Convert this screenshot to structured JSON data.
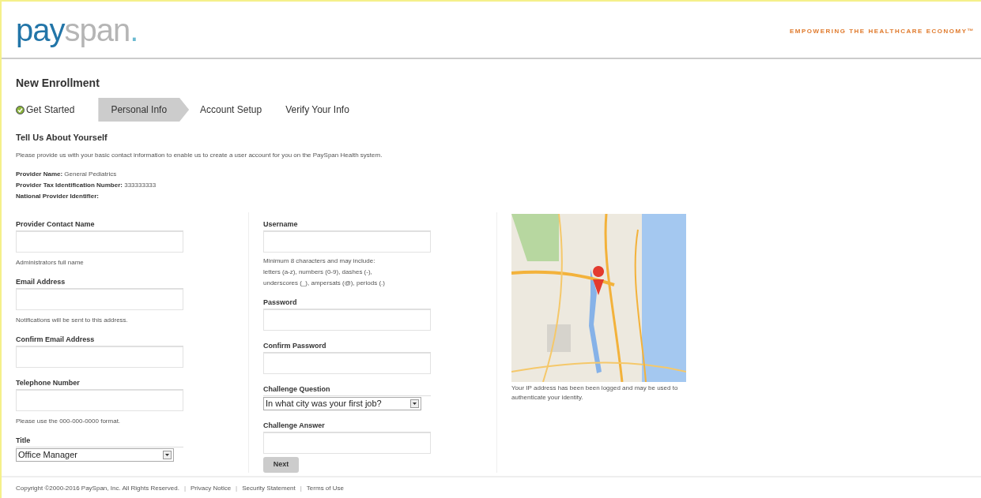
{
  "header": {
    "logo": {
      "first": "pay",
      "second": "span",
      "dot": "."
    },
    "tagline": "EMPOWERING THE HEALTHCARE ECONOMY™"
  },
  "title": "New Enrollment",
  "steps": [
    {
      "label": "Get Started",
      "done": true,
      "selected": false
    },
    {
      "label": "Personal Info",
      "done": false,
      "selected": true
    },
    {
      "label": "Account Setup",
      "done": false,
      "selected": false
    },
    {
      "label": "Verify Your Info",
      "done": false,
      "selected": false
    }
  ],
  "section_title": "Tell Us About Yourself",
  "intro": "Please provide us with your basic contact information to enable us to create a user account for you on the PaySpan Health system.",
  "provider_info": [
    {
      "label": "Provider Name:",
      "value": "General Pediatrics"
    },
    {
      "label": "Provider Tax Identification Number:",
      "value": "333333333"
    },
    {
      "label": "National Provider Identifier:"
    }
  ],
  "left_fields": [
    {
      "kind": "text",
      "label": "Provider Contact Name",
      "hint": "Administrators full name"
    },
    {
      "kind": "text",
      "label": "Email Address",
      "hint": "Notifications will be sent to this address."
    },
    {
      "kind": "text",
      "label": "Confirm Email Address"
    },
    {
      "kind": "text",
      "label": "Telephone Number",
      "hint": "Please use the 000-000-0000 format."
    },
    {
      "kind": "select",
      "label": "Title",
      "value": "Office Manager"
    }
  ],
  "right_fields": [
    {
      "kind": "text",
      "label": "Username",
      "hint_lines": [
        "Minimum 8 characters and may include:",
        "letters (a-z), numbers (0-9), dashes (-),",
        "underscores (_), ampersats (@), periods (.)"
      ]
    },
    {
      "kind": "text",
      "label": "Password"
    },
    {
      "kind": "text",
      "label": "Confirm Password"
    },
    {
      "kind": "select",
      "label": "Challenge Question",
      "value": "In what city was your first job?"
    },
    {
      "kind": "text",
      "label": "Challenge Answer"
    }
  ],
  "next_button": "Next",
  "map": {
    "kind": "picture",
    "caption": "Your IP address has been been logged and may be used to authenticate your identity."
  },
  "footer": {
    "copyright": "Copyright ©2000-2016 PaySpan, Inc. All Rights Reserved.",
    "separator": "|",
    "links": [
      "Privacy Notice",
      "Security Statement",
      "Terms of Use"
    ]
  }
}
